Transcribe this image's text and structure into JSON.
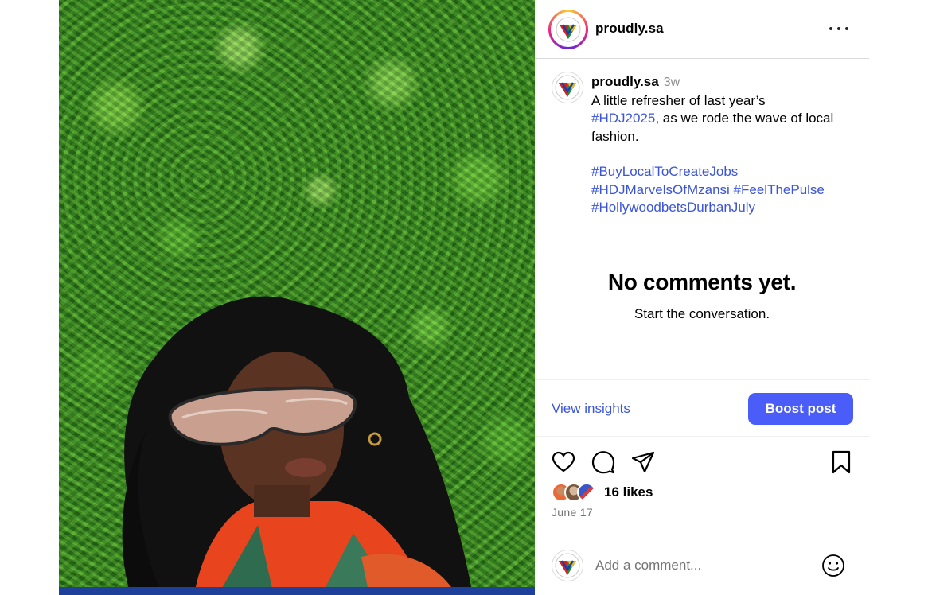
{
  "post": {
    "username": "proudly.sa",
    "time_ago": "3w",
    "caption_line": "A little refresher of last year’s",
    "caption_tag": "#HDJ2025",
    "caption_rest": ", as we rode the wave of local fashion.",
    "hashtags": [
      "#BuyLocalToCreateJobs",
      "#HDJMarvelsOfMzansi",
      "#FeelThePulse",
      "#HollywoodbetsDurbanJuly"
    ]
  },
  "comments": {
    "empty_title": "No comments yet.",
    "empty_subtitle": "Start the conversation."
  },
  "insights": {
    "view_label": "View insights",
    "boost_label": "Boost post"
  },
  "engagement": {
    "likes": "16 likes",
    "date": "June 17"
  },
  "comment_box": {
    "placeholder": "Add a comment..."
  },
  "icons": {
    "more": "more-options-icon",
    "like": "heart-icon",
    "comment": "comment-bubble-icon",
    "share": "paper-plane-icon",
    "save": "bookmark-icon",
    "emoji": "emoji-icon"
  },
  "colors": {
    "link": "#3b55d9",
    "boost_button": "#4a5df9",
    "muted": "#737373"
  }
}
